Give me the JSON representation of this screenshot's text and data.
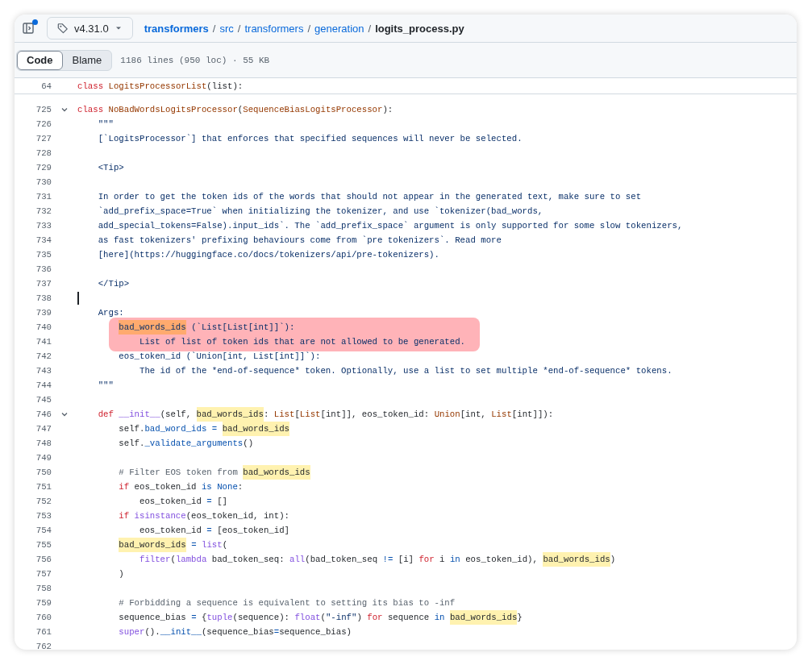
{
  "header": {
    "panel_notification": true,
    "version": "v4.31.0",
    "breadcrumb": [
      {
        "label": "transformers",
        "selected": false
      },
      {
        "label": "src",
        "selected": false
      },
      {
        "label": "transformers",
        "selected": false
      },
      {
        "label": "generation",
        "selected": false
      },
      {
        "label": "logits_process.py",
        "selected": true
      }
    ],
    "separator": "/"
  },
  "toolbar": {
    "tabs": [
      {
        "label": "Code",
        "selected": true
      },
      {
        "label": "Blame",
        "selected": false
      }
    ],
    "info": "1186 lines (950 loc) · 55 KB"
  },
  "sticky_line": {
    "number": "64",
    "tokens": [
      {
        "text": "class ",
        "kind": "kw"
      },
      {
        "text": "LogitsProcessorList",
        "kind": "cls"
      },
      {
        "text": "(list):",
        "kind": "plain"
      }
    ]
  },
  "lines": [
    {
      "number": "725",
      "foldable": true,
      "cursor": false,
      "marked": false,
      "tokens": [
        {
          "text": "class ",
          "kind": "kw"
        },
        {
          "text": "NoBadWordsLogitsProcessor",
          "kind": "cls"
        },
        {
          "text": "(",
          "kind": "plain"
        },
        {
          "text": "SequenceBiasLogitsProcessor",
          "kind": "cls"
        },
        {
          "text": "):",
          "kind": "plain"
        }
      ]
    },
    {
      "number": "726",
      "foldable": false,
      "cursor": false,
      "marked": false,
      "tokens": [
        {
          "text": "    \"\"\"",
          "kind": "doc"
        }
      ]
    },
    {
      "number": "727",
      "foldable": false,
      "cursor": false,
      "marked": false,
      "tokens": [
        {
          "text": "    [`LogitsProcessor`] that enforces that specified sequences will never be selected.",
          "kind": "doc"
        }
      ]
    },
    {
      "number": "728",
      "foldable": false,
      "cursor": false,
      "marked": false
    },
    {
      "number": "729",
      "foldable": false,
      "cursor": false,
      "marked": false,
      "tokens": [
        {
          "text": "    <Tip>",
          "kind": "doc"
        }
      ]
    },
    {
      "number": "730",
      "foldable": false,
      "cursor": false,
      "marked": false
    },
    {
      "number": "731",
      "foldable": false,
      "cursor": false,
      "marked": false,
      "tokens": [
        {
          "text": "    In order to get the token ids of the words that should not appear in the generated text, make sure to set",
          "kind": "doc"
        }
      ]
    },
    {
      "number": "732",
      "foldable": false,
      "cursor": false,
      "marked": false,
      "tokens": [
        {
          "text": "    `add_prefix_space=True` when initializing the tokenizer, and use `tokenizer(bad_words,",
          "kind": "doc"
        }
      ]
    },
    {
      "number": "733",
      "foldable": false,
      "cursor": false,
      "marked": false,
      "tokens": [
        {
          "text": "    add_special_tokens=False).input_ids`. The `add_prefix_space` argument is only supported for some slow tokenizers,",
          "kind": "doc"
        }
      ]
    },
    {
      "number": "734",
      "foldable": false,
      "cursor": false,
      "marked": false,
      "tokens": [
        {
          "text": "    as fast tokenizers' prefixing behaviours come from `pre tokenizers`. Read more",
          "kind": "doc"
        }
      ]
    },
    {
      "number": "735",
      "foldable": false,
      "cursor": false,
      "marked": false,
      "tokens": [
        {
          "text": "    [here](https://huggingface.co/docs/tokenizers/api/pre-tokenizers).",
          "kind": "doc"
        }
      ]
    },
    {
      "number": "736",
      "foldable": false,
      "cursor": false,
      "marked": false
    },
    {
      "number": "737",
      "foldable": false,
      "cursor": false,
      "marked": false,
      "tokens": [
        {
          "text": "    </Tip>",
          "kind": "doc"
        }
      ]
    },
    {
      "number": "738",
      "foldable": false,
      "cursor": true,
      "marked": false
    },
    {
      "number": "739",
      "foldable": false,
      "cursor": false,
      "marked": false,
      "tokens": [
        {
          "text": "    Args:",
          "kind": "doc"
        }
      ]
    },
    {
      "number": "740",
      "foldable": false,
      "cursor": false,
      "marked": true,
      "tokens": [
        {
          "text": "        bad_words_ids",
          "kind": "match_active"
        },
        {
          "text": " (`List[List[int]]`):",
          "kind": "doc"
        }
      ]
    },
    {
      "number": "741",
      "foldable": false,
      "cursor": false,
      "marked": true,
      "tokens": [
        {
          "text": "            List of list of token ids that are not allowed to be generated.",
          "kind": "doc"
        }
      ]
    },
    {
      "number": "742",
      "foldable": false,
      "cursor": false,
      "marked": false,
      "tokens": [
        {
          "text": "        eos_token_id (`Union[int, List[int]]`):",
          "kind": "doc"
        }
      ]
    },
    {
      "number": "743",
      "foldable": false,
      "cursor": false,
      "marked": false,
      "tokens": [
        {
          "text": "            The id of the *end-of-sequence* token. Optionally, use a list to set multiple *end-of-sequence* tokens.",
          "kind": "doc"
        }
      ]
    },
    {
      "number": "744",
      "foldable": false,
      "cursor": false,
      "marked": false,
      "tokens": [
        {
          "text": "    \"\"\"",
          "kind": "doc"
        }
      ]
    },
    {
      "number": "745",
      "foldable": false,
      "cursor": false,
      "marked": false
    },
    {
      "number": "746",
      "foldable": true,
      "cursor": false,
      "marked": false,
      "tokens": [
        {
          "text": "    def ",
          "kind": "kw"
        },
        {
          "text": "__init__",
          "kind": "fn"
        },
        {
          "text": "(self, ",
          "kind": "plain"
        },
        {
          "text": "bad_words_ids",
          "kind": "match"
        },
        {
          "text": ": ",
          "kind": "plain"
        },
        {
          "text": "List",
          "kind": "cls"
        },
        {
          "text": "[",
          "kind": "plain"
        },
        {
          "text": "List",
          "kind": "cls"
        },
        {
          "text": "[int]], eos_token_id: ",
          "kind": "plain"
        },
        {
          "text": "Union",
          "kind": "cls"
        },
        {
          "text": "[int, ",
          "kind": "plain"
        },
        {
          "text": "List",
          "kind": "cls"
        },
        {
          "text": "[int]]):",
          "kind": "plain"
        }
      ]
    },
    {
      "number": "747",
      "foldable": false,
      "cursor": false,
      "marked": false,
      "tokens": [
        {
          "text": "        self.",
          "kind": "plain"
        },
        {
          "text": "bad_word_ids",
          "kind": "attr"
        },
        {
          "text": " = ",
          "kind": "op"
        },
        {
          "text": "bad_words_ids",
          "kind": "match"
        }
      ]
    },
    {
      "number": "748",
      "foldable": false,
      "cursor": false,
      "marked": false,
      "tokens": [
        {
          "text": "        self.",
          "kind": "plain"
        },
        {
          "text": "_validate_arguments",
          "kind": "attr"
        },
        {
          "text": "()",
          "kind": "plain"
        }
      ]
    },
    {
      "number": "749",
      "foldable": false,
      "cursor": false,
      "marked": false
    },
    {
      "number": "750",
      "foldable": false,
      "cursor": false,
      "marked": false,
      "tokens": [
        {
          "text": "        # Filter EOS token from ",
          "kind": "comment"
        },
        {
          "text": "bad_words_ids",
          "kind": "match"
        }
      ]
    },
    {
      "number": "751",
      "foldable": false,
      "cursor": false,
      "marked": false,
      "tokens": [
        {
          "text": "        if",
          "kind": "kw"
        },
        {
          "text": " eos_token_id ",
          "kind": "plain"
        },
        {
          "text": "is ",
          "kind": "op"
        },
        {
          "text": "None",
          "kind": "op"
        },
        {
          "text": ":",
          "kind": "plain"
        }
      ]
    },
    {
      "number": "752",
      "foldable": false,
      "cursor": false,
      "marked": false,
      "tokens": [
        {
          "text": "            eos_token_id ",
          "kind": "plain"
        },
        {
          "text": "=",
          "kind": "op"
        },
        {
          "text": " []",
          "kind": "plain"
        }
      ]
    },
    {
      "number": "753",
      "foldable": false,
      "cursor": false,
      "marked": false,
      "tokens": [
        {
          "text": "        if ",
          "kind": "kw"
        },
        {
          "text": "isinstance",
          "kind": "fn"
        },
        {
          "text": "(eos_token_id, int):",
          "kind": "plain"
        }
      ]
    },
    {
      "number": "754",
      "foldable": false,
      "cursor": false,
      "marked": false,
      "tokens": [
        {
          "text": "            eos_token_id ",
          "kind": "plain"
        },
        {
          "text": "=",
          "kind": "op"
        },
        {
          "text": " [eos_token_id]",
          "kind": "plain"
        }
      ]
    },
    {
      "number": "755",
      "foldable": false,
      "cursor": false,
      "marked": false,
      "tokens": [
        {
          "text": "        bad_words_ids",
          "kind": "match"
        },
        {
          "text": " = ",
          "kind": "op"
        },
        {
          "text": "list",
          "kind": "fn"
        },
        {
          "text": "(",
          "kind": "plain"
        }
      ]
    },
    {
      "number": "756",
      "foldable": false,
      "cursor": false,
      "marked": false,
      "tokens": [
        {
          "text": "            filter",
          "kind": "fn"
        },
        {
          "text": "(",
          "kind": "plain"
        },
        {
          "text": "lambda",
          "kind": "fn"
        },
        {
          "text": " bad_token_seq: ",
          "kind": "plain"
        },
        {
          "text": "all",
          "kind": "fn"
        },
        {
          "text": "(bad_token_seq ",
          "kind": "plain"
        },
        {
          "text": "!=",
          "kind": "op"
        },
        {
          "text": " [i] ",
          "kind": "plain"
        },
        {
          "text": "for",
          "kind": "kw"
        },
        {
          "text": " i ",
          "kind": "plain"
        },
        {
          "text": "in",
          "kind": "op"
        },
        {
          "text": " eos_token_id), ",
          "kind": "plain"
        },
        {
          "text": "bad_words_ids",
          "kind": "match"
        },
        {
          "text": ")",
          "kind": "plain"
        }
      ]
    },
    {
      "number": "757",
      "foldable": false,
      "cursor": false,
      "marked": false,
      "tokens": [
        {
          "text": "        )",
          "kind": "plain"
        }
      ]
    },
    {
      "number": "758",
      "foldable": false,
      "cursor": false,
      "marked": false
    },
    {
      "number": "759",
      "foldable": false,
      "cursor": false,
      "marked": false,
      "tokens": [
        {
          "text": "        # Forbidding a sequence is equivalent to setting its bias to -inf",
          "kind": "comment"
        }
      ]
    },
    {
      "number": "760",
      "foldable": false,
      "cursor": false,
      "marked": false,
      "tokens": [
        {
          "text": "        sequence_bias ",
          "kind": "plain"
        },
        {
          "text": "=",
          "kind": "op"
        },
        {
          "text": " {",
          "kind": "plain"
        },
        {
          "text": "tuple",
          "kind": "fn"
        },
        {
          "text": "(sequence): ",
          "kind": "plain"
        },
        {
          "text": "float",
          "kind": "fn"
        },
        {
          "text": "(",
          "kind": "plain"
        },
        {
          "text": "\"-inf\"",
          "kind": "str"
        },
        {
          "text": ") ",
          "kind": "plain"
        },
        {
          "text": "for",
          "kind": "kw"
        },
        {
          "text": " sequence ",
          "kind": "plain"
        },
        {
          "text": "in ",
          "kind": "op"
        },
        {
          "text": "bad_words_ids",
          "kind": "match"
        },
        {
          "text": "}",
          "kind": "plain"
        }
      ]
    },
    {
      "number": "761",
      "foldable": false,
      "cursor": false,
      "marked": false,
      "tokens": [
        {
          "text": "        super",
          "kind": "fn"
        },
        {
          "text": "().",
          "kind": "plain"
        },
        {
          "text": "__init__",
          "kind": "attr"
        },
        {
          "text": "(sequence_bias",
          "kind": "plain"
        },
        {
          "text": "=",
          "kind": "op"
        },
        {
          "text": "sequence_bias)",
          "kind": "plain"
        }
      ]
    },
    {
      "number": "762",
      "foldable": false,
      "cursor": false,
      "marked": false
    }
  ]
}
